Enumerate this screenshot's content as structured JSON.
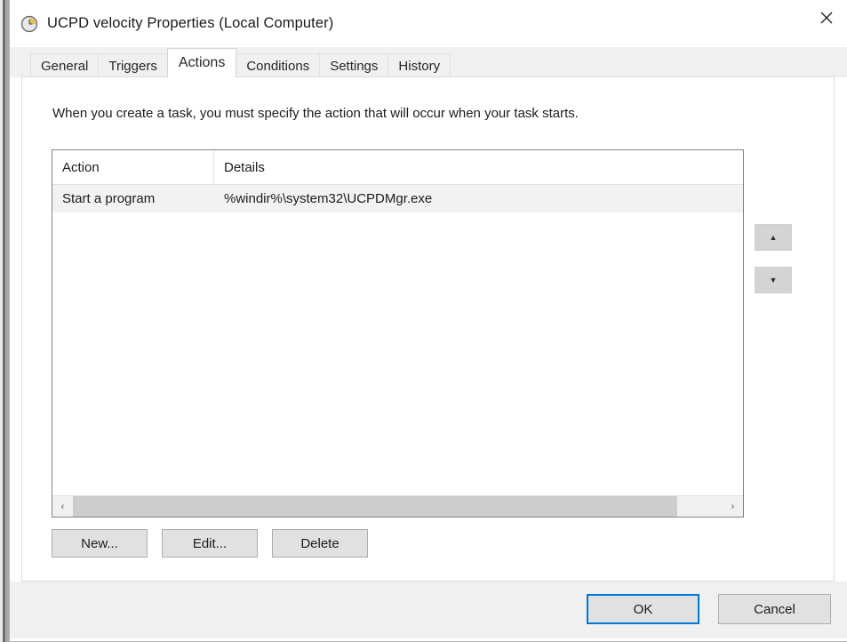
{
  "window": {
    "title": "UCPD velocity Properties (Local Computer)",
    "icon": "clock-task-icon",
    "close_label": "✕",
    "accent_color": "#0078d7"
  },
  "tabs": [
    {
      "label": "General",
      "selected": false
    },
    {
      "label": "Triggers",
      "selected": false
    },
    {
      "label": "Actions",
      "selected": true
    },
    {
      "label": "Conditions",
      "selected": false
    },
    {
      "label": "Settings",
      "selected": false
    },
    {
      "label": "History",
      "selected": false
    }
  ],
  "content": {
    "description": "When you create a task, you must specify the action that will occur when your task starts.",
    "list": {
      "columns": [
        "Action",
        "Details"
      ],
      "rows": [
        {
          "action": "Start a program",
          "details": "%windir%\\system32\\UCPDMgr.exe",
          "selected": true
        }
      ],
      "scrollbar": {
        "left_arrow": "‹",
        "right_arrow": "›",
        "thumb_percent": 93
      }
    },
    "move_buttons": {
      "up": "▲",
      "down": "▼"
    },
    "action_buttons": [
      {
        "label": "New..."
      },
      {
        "label": "Edit..."
      },
      {
        "label": "Delete"
      }
    ]
  },
  "footer": {
    "ok_label": "OK",
    "cancel_label": "Cancel"
  }
}
